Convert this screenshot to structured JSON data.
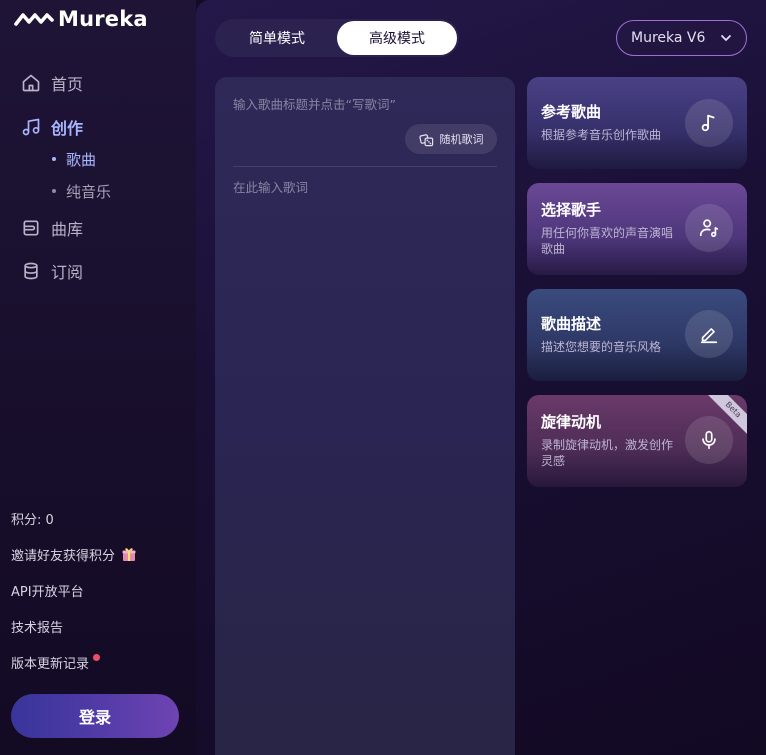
{
  "logo": {
    "text": "Mureka"
  },
  "sidebar": {
    "nav": [
      {
        "label": "首页",
        "icon": "home-icon"
      },
      {
        "label": "创作",
        "icon": "music-note-icon",
        "active": true
      },
      {
        "label": "曲库",
        "icon": "library-icon"
      },
      {
        "label": "订阅",
        "icon": "database-icon"
      }
    ],
    "sub": [
      {
        "label": "歌曲",
        "active": true
      },
      {
        "label": "纯音乐"
      }
    ],
    "links": {
      "points": "积分: 0",
      "invite": "邀请好友获得积分",
      "api": "API开放平台",
      "report": "技术报告",
      "changelog": "版本更新记录"
    },
    "login": "登录"
  },
  "main": {
    "modes": {
      "simple": "简单模式",
      "advanced": "高级模式",
      "selected": "advanced"
    },
    "model": "Mureka V6",
    "editor": {
      "title_placeholder": "输入歌曲标题并点击“写歌词”",
      "random_button": "随机歌词",
      "lyrics_placeholder": "在此输入歌词"
    },
    "cards": [
      {
        "title": "参考歌曲",
        "desc": "根据参考音乐创作歌曲",
        "icon": "music-note-icon"
      },
      {
        "title": "选择歌手",
        "desc": "用任何你喜欢的声音演唱歌曲",
        "icon": "singer-icon"
      },
      {
        "title": "歌曲描述",
        "desc": "描述您想要的音乐风格",
        "icon": "pencil-icon"
      },
      {
        "title": "旋律动机",
        "desc": "录制旋律动机，激发创作灵感",
        "icon": "microphone-icon",
        "badge": "Beta"
      }
    ]
  },
  "colors": {
    "accent": "#a9b6ff",
    "login_gradient_start": "#38359a",
    "login_gradient_end": "#6e44b2",
    "notify_dot": "#f04d6a"
  }
}
